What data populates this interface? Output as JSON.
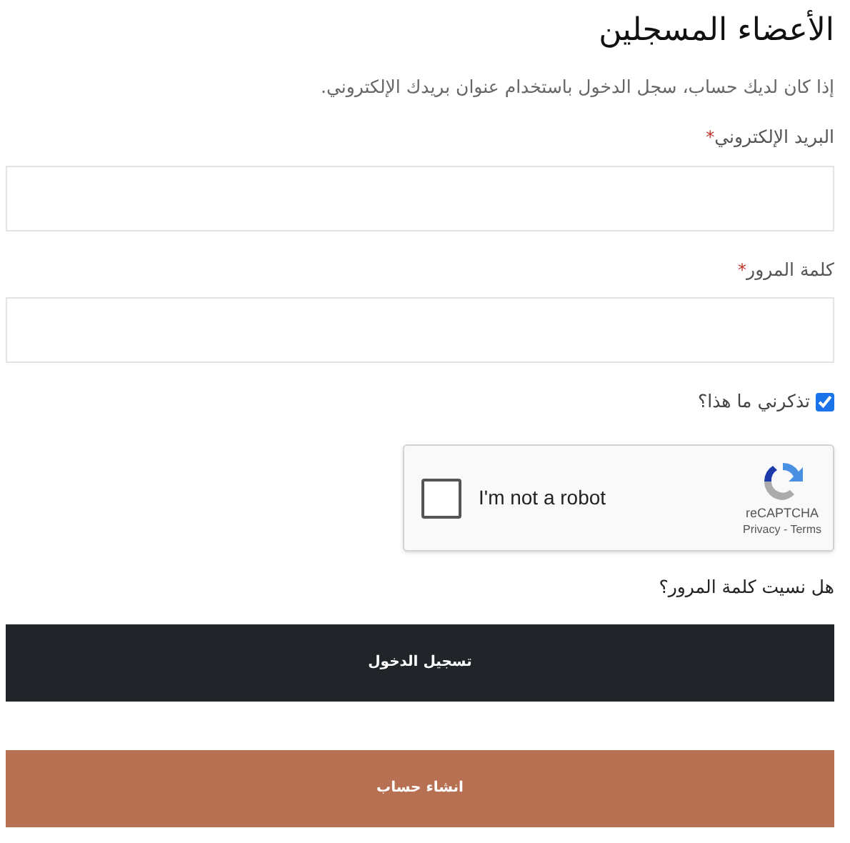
{
  "title": "الأعضاء المسجلين",
  "intro": "إذا كان لديك حساب، سجل الدخول باستخدام عنوان بريدك الإلكتروني.",
  "fields": [
    {
      "label": "البريد الإلكتروني",
      "required_mark": "*"
    },
    {
      "label": "كلمة المرور",
      "required_mark": "*"
    }
  ],
  "remember": {
    "label": "تذكرني ما هذا؟",
    "checked": true
  },
  "captcha": {
    "checked": false,
    "label": "I'm not a robot",
    "brand": "reCAPTCHA",
    "links": "Privacy - Terms"
  },
  "forgot_link": "هل نسيت كلمة المرور؟",
  "buttons": [
    {
      "label": "تسجيل الدخول",
      "kind": "primary"
    },
    {
      "label": "انشاء حساب",
      "kind": "secondary"
    }
  ]
}
